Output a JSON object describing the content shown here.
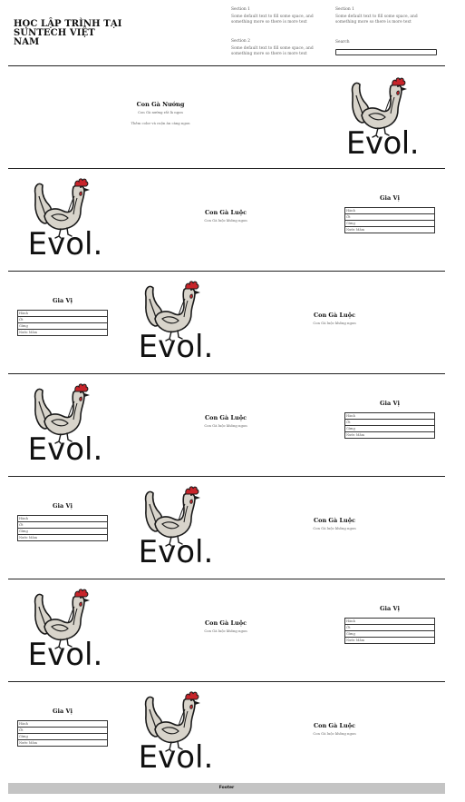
{
  "header": {
    "brand": "HỌC LẬP TRÌNH TẠI SUNTECH VIỆT NAM",
    "section_a": {
      "title": "Section 1",
      "text": "Some default text to fill some space, and something more so there is more text"
    },
    "section_b": {
      "title": "Section 1",
      "text": "Some default text to fill some space, and something more so there is more text"
    },
    "section_c": {
      "title": "Section 2",
      "text": "Some default text to fill some space, and something more so there is more text"
    },
    "search": {
      "label": "Search",
      "placeholder": ""
    }
  },
  "logo": {
    "text": "Evol.",
    "icon": "rooster-icon"
  },
  "hero": {
    "title": "Con Gà Nướng",
    "line1": "Con Gà nướng rất là ngon",
    "line2": "Thêm color và cuộn ăn càng ngon"
  },
  "spice": {
    "title": "Gia Vị",
    "items": [
      "Hành",
      "Ớt",
      "Gừng",
      "Nước Mắm"
    ]
  },
  "boiled": {
    "title": "Con Gà Luộc",
    "text": "Con Gà luộc không ngon"
  },
  "footer": {
    "label": "Footer"
  },
  "colors": {
    "comb": "#c8242a",
    "body": "#d8d4cb",
    "outline": "#1a1a1a",
    "footer_bg": "#c4c4c4"
  }
}
